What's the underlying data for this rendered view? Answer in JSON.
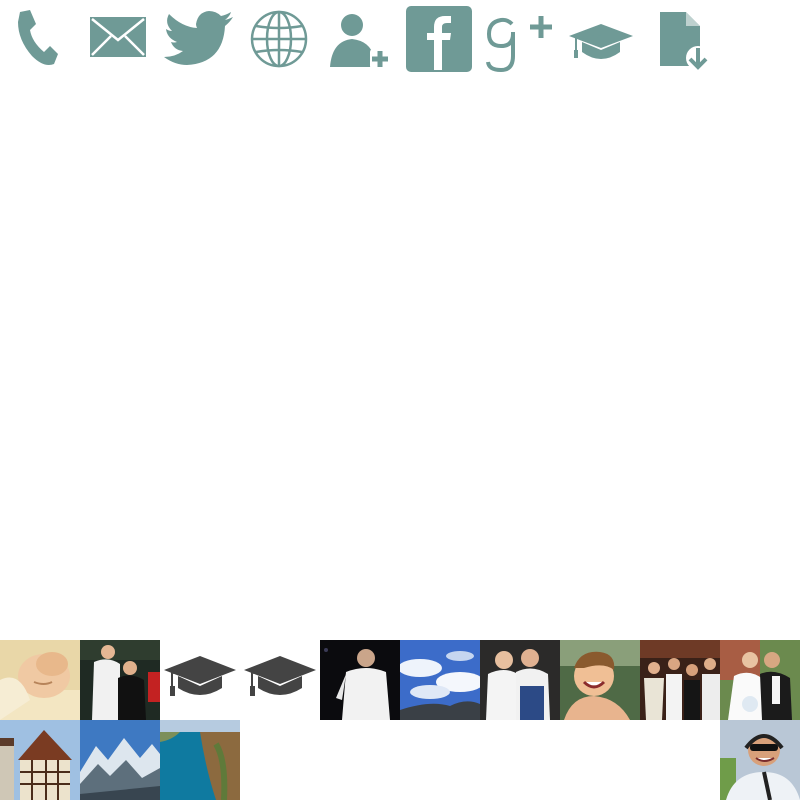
{
  "toolbar": {
    "icon_color": "#6f9a96",
    "icons": [
      {
        "name": "phone-icon"
      },
      {
        "name": "mail-icon"
      },
      {
        "name": "twitter-icon"
      },
      {
        "name": "globe-icon"
      },
      {
        "name": "add-contact-icon"
      },
      {
        "name": "facebook-icon"
      },
      {
        "name": "google-plus-icon"
      },
      {
        "name": "graduation-cap-icon"
      },
      {
        "name": "download-document-icon"
      }
    ]
  },
  "gallery": {
    "placeholder_icon_color": "#444444",
    "tiles": [
      {
        "name": "photo-baby-sleeping"
      },
      {
        "name": "photo-two-chefs"
      },
      {
        "name": "graduation-cap-icon"
      },
      {
        "name": "graduation-cap-icon"
      },
      {
        "name": "photo-man-night"
      },
      {
        "name": "photo-sky-clouds"
      },
      {
        "name": "photo-couple-chefs"
      },
      {
        "name": "photo-smiling-child"
      },
      {
        "name": "photo-group-party"
      },
      {
        "name": "photo-wedding-couple"
      },
      {
        "name": "photo-timbered-house"
      },
      {
        "name": "photo-mountains"
      },
      {
        "name": "photo-coast-aerial"
      },
      {
        "name": "photo-pilot-headset"
      }
    ]
  }
}
